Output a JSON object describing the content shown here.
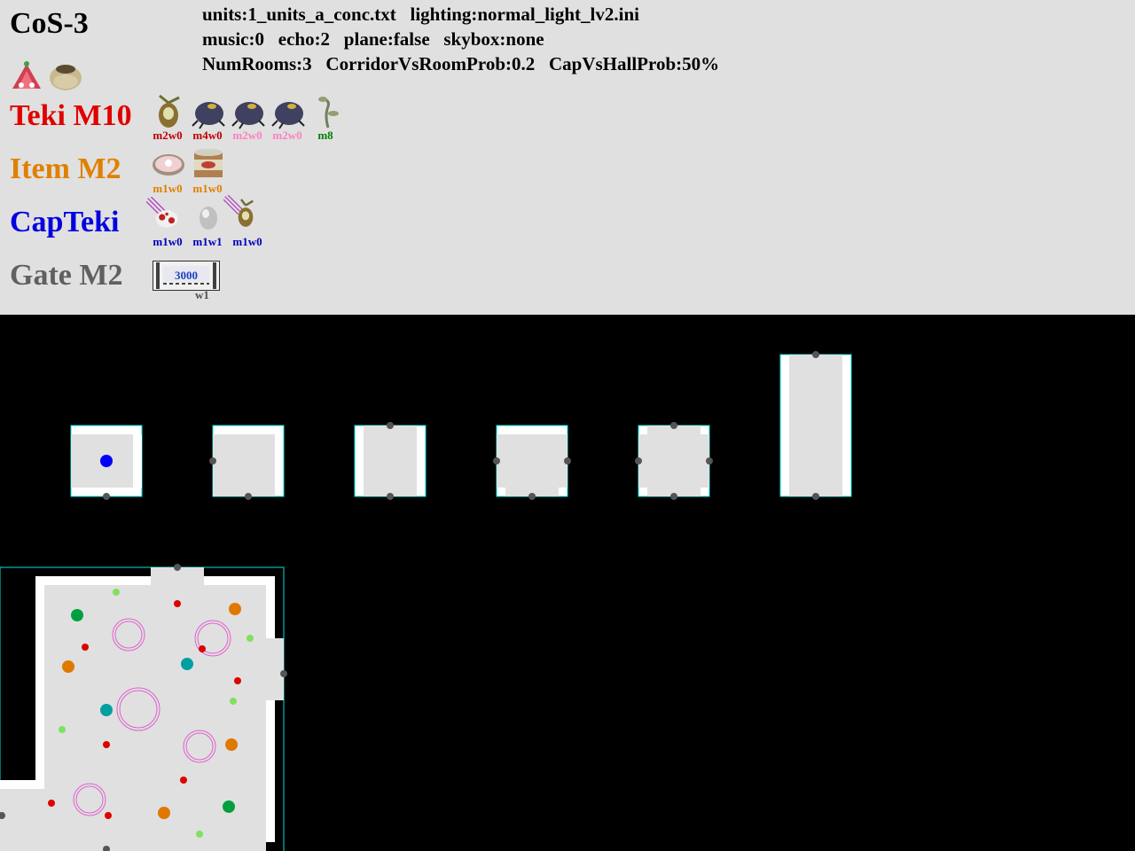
{
  "title": "CoS-3",
  "config": {
    "line1": "units:1_units_a_conc.txt   lighting:normal_light_lv2.ini",
    "line2": "music:0   echo:2   plane:false   skybox:none",
    "line3": "NumRooms:3   CorridorVsRoomProb:0.2   CapVsHallProb:50%"
  },
  "header_icons": [
    "red-flower-plant-icon",
    "clay-pot-icon"
  ],
  "rows": {
    "teki": {
      "label": "Teki M10",
      "color": "#e00000",
      "entries": [
        {
          "icon": "dwarf-bulborb-sprout-icon",
          "caption": "m2w0",
          "color": "#c00000"
        },
        {
          "icon": "beetle-icon",
          "caption": "m4w0",
          "color": "#c00000"
        },
        {
          "icon": "beetle-icon",
          "caption": "m2w0",
          "color": "#ff80c0"
        },
        {
          "icon": "beetle-icon",
          "caption": "m2w0",
          "color": "#ff80c0"
        },
        {
          "icon": "plant-sprout-icon",
          "caption": "m8",
          "color": "#008000"
        }
      ]
    },
    "item": {
      "label": "Item M2",
      "color": "#e08000",
      "entries": [
        {
          "icon": "pink-shell-treasure-icon",
          "caption": "m1w0",
          "color": "#e08000"
        },
        {
          "icon": "tin-can-treasure-icon",
          "caption": "m1w0",
          "color": "#e08000"
        }
      ]
    },
    "capteki": {
      "label": "CapTeki",
      "color": "#0000e0",
      "entries": [
        {
          "icon": "falling-spotted-creature-icon",
          "caption": "m1w0",
          "color": "#0000c0"
        },
        {
          "icon": "egg-icon",
          "caption": "m1w1",
          "color": "#0000c0"
        },
        {
          "icon": "falling-bulb-sprout-icon",
          "caption": "m1w0",
          "color": "#0000c0"
        }
      ]
    },
    "gate": {
      "label": "Gate M2",
      "color": "#606060",
      "entries": [
        {
          "icon": "gate-icon",
          "caption": "w1",
          "color": "#505050",
          "value": "3000"
        }
      ]
    }
  },
  "map": {
    "colors": {
      "background": "#000000",
      "floor": "#e0e0e0",
      "wall": "#ffffff",
      "border": "#00e0e0",
      "door": "#555555",
      "start": "#0000ff",
      "red": "#dd0000",
      "orange": "#e07800",
      "green": "#00a040",
      "teal": "#00a0a0",
      "lightgreen": "#80e060",
      "ring": "#e060d0"
    },
    "spawn_legend": [
      {
        "name": "start-point",
        "color": "#0000ff"
      },
      {
        "name": "teki-spawn",
        "color": "#dd0000"
      },
      {
        "name": "item-spawn",
        "color": "#e07800"
      },
      {
        "name": "plant-spawn",
        "color": "#80e060"
      },
      {
        "name": "treasure-spawn",
        "color": "#00a040"
      },
      {
        "name": "capteki-spawn",
        "color": "#00a0a0"
      }
    ]
  }
}
